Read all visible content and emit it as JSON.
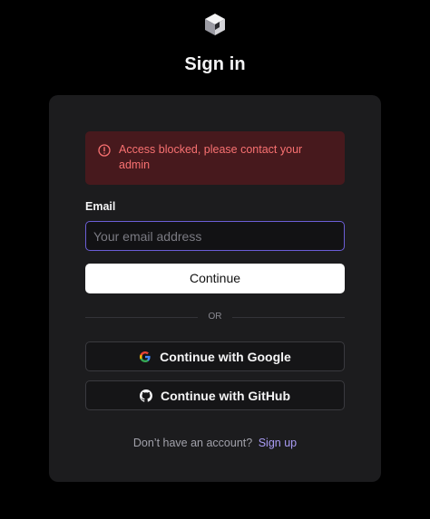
{
  "header": {
    "logo_icon": "cube-logo-icon",
    "title": "Sign in"
  },
  "alert": {
    "icon": "alert-circle-icon",
    "message": "Access blocked, please contact your admin",
    "color": "#f87171",
    "background": "#47191d"
  },
  "form": {
    "email_label": "Email",
    "email_placeholder": "Your email address",
    "email_value": "",
    "continue_label": "Continue",
    "divider_label": "OR"
  },
  "oauth": {
    "google_label": "Continue with Google",
    "google_icon": "google-icon",
    "github_label": "Continue with GitHub",
    "github_icon": "github-icon"
  },
  "footer": {
    "prompt": "Don’t have an account?",
    "signup_label": "Sign up",
    "link_color": "#a99cf5"
  },
  "colors": {
    "background": "#000000",
    "card": "#1c1c1e",
    "focus_ring": "#6b5ed6"
  }
}
